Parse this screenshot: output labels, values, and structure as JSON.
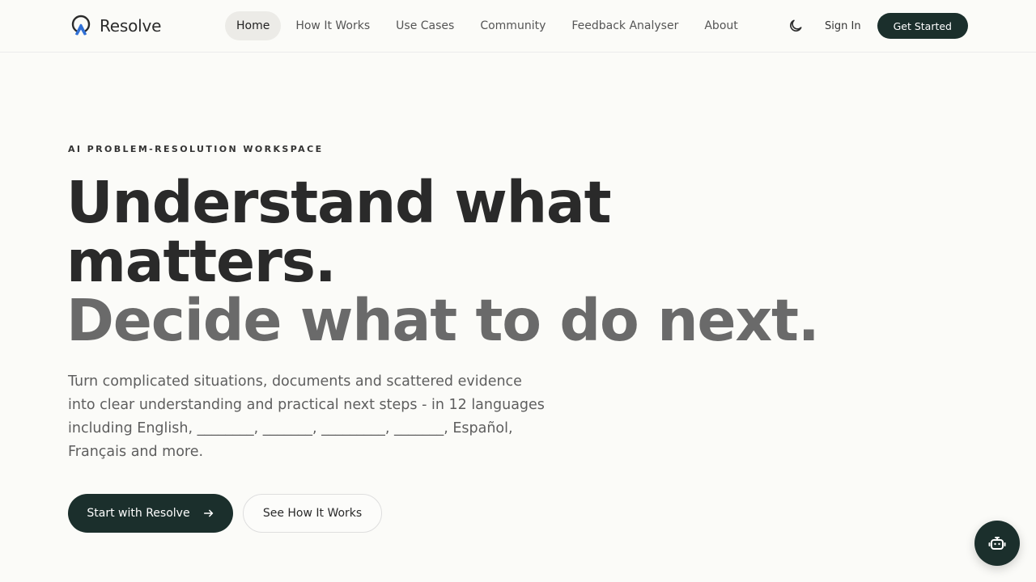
{
  "brand": {
    "name": "Resolve",
    "logo_icon": "resolve-logo-icon",
    "accent_color": "#2f6fd6"
  },
  "nav": {
    "links": [
      "Home",
      "How It Works",
      "Use Cases",
      "Community",
      "Feedback Analyser",
      "About"
    ],
    "active": "Home",
    "theme_icon": "moon-icon",
    "sign_in": "Sign In",
    "get_started": "Get Started"
  },
  "hero": {
    "eyebrow": "AI PROBLEM-RESOLUTION WORKSPACE",
    "headline_line1": "Understand what",
    "headline_line2": "matters.",
    "headline_line3": "Decide what to do next.",
    "subtext": "Turn complicated situations, documents and scattered evidence into clear understanding and practical next steps - in 12 languages including English, ________, _______, _________, _______, Español, Français and more.",
    "primary_cta": "Start with Resolve",
    "primary_cta_icon": "arrow-right-icon",
    "secondary_cta": "See How It Works"
  },
  "chat": {
    "icon": "robot-icon"
  },
  "colors": {
    "background": "#fbfbf8",
    "primary": "#1b2f2c",
    "muted_text": "#6a6a6a"
  }
}
